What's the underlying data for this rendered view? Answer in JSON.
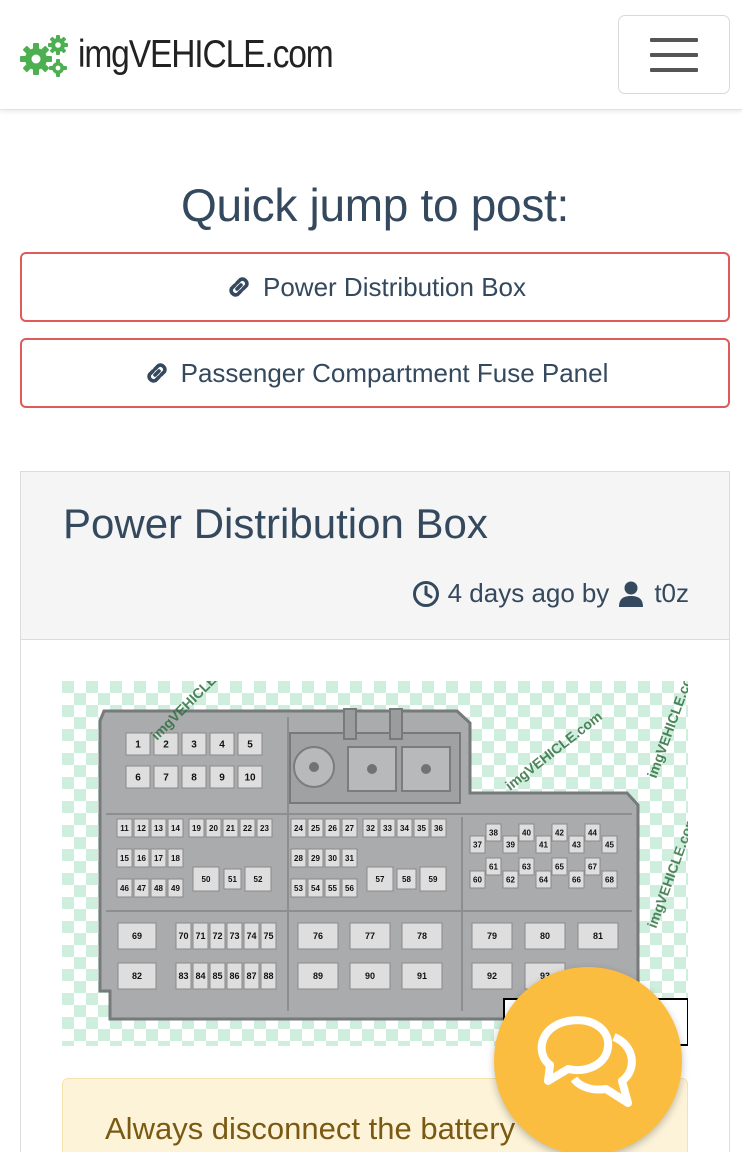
{
  "header": {
    "brand": "imgVEHICLE.com",
    "logo_icon": "gears-icon",
    "menu_icon": "hamburger-icon",
    "brand_color": "#4caf50"
  },
  "quick_jump": {
    "title": "Quick jump to post:",
    "links": [
      {
        "label": "Power Distribution Box",
        "icon": "link-icon"
      },
      {
        "label": "Passenger Compartment Fuse Panel",
        "icon": "link-icon"
      }
    ],
    "border_color": "#e05a5a"
  },
  "post": {
    "title": "Power Distribution Box",
    "time": "4 days ago",
    "by": "by",
    "author": "t0z",
    "clock_icon": "clock-icon",
    "user_icon": "user-icon"
  },
  "diagram": {
    "watermark": "imgVEHICLE.com",
    "fuses": {
      "row1": [
        "1",
        "2",
        "3",
        "4",
        "5"
      ],
      "row2": [
        "6",
        "7",
        "8",
        "9",
        "10"
      ],
      "row3": [
        "11",
        "12",
        "13",
        "14",
        "19",
        "20",
        "21",
        "22",
        "23",
        "24",
        "25",
        "26",
        "27",
        "32",
        "33",
        "34",
        "35",
        "36"
      ],
      "row4": [
        "15",
        "16",
        "17",
        "18",
        "28",
        "29",
        "30",
        "31"
      ],
      "row5": [
        "46",
        "47",
        "48",
        "49",
        "50",
        "51",
        "52",
        "53",
        "54",
        "55",
        "56",
        "57",
        "58",
        "59"
      ],
      "right_top": [
        "38",
        "40",
        "42",
        "44",
        "37",
        "39",
        "41",
        "43",
        "45",
        "61",
        "63",
        "65",
        "67",
        "60",
        "62",
        "64",
        "66",
        "68"
      ],
      "row6": [
        "69",
        "70",
        "71",
        "72",
        "73",
        "74",
        "75",
        "76",
        "77",
        "78",
        "79",
        "80",
        "81"
      ],
      "row7": [
        "82",
        "83",
        "84",
        "85",
        "86",
        "87",
        "88",
        "89",
        "90",
        "91",
        "92",
        "93"
      ]
    }
  },
  "notice": {
    "text": "Always disconnect the battery"
  },
  "chat": {
    "icon": "chat-bubbles-icon",
    "color": "#fbbd3f"
  }
}
